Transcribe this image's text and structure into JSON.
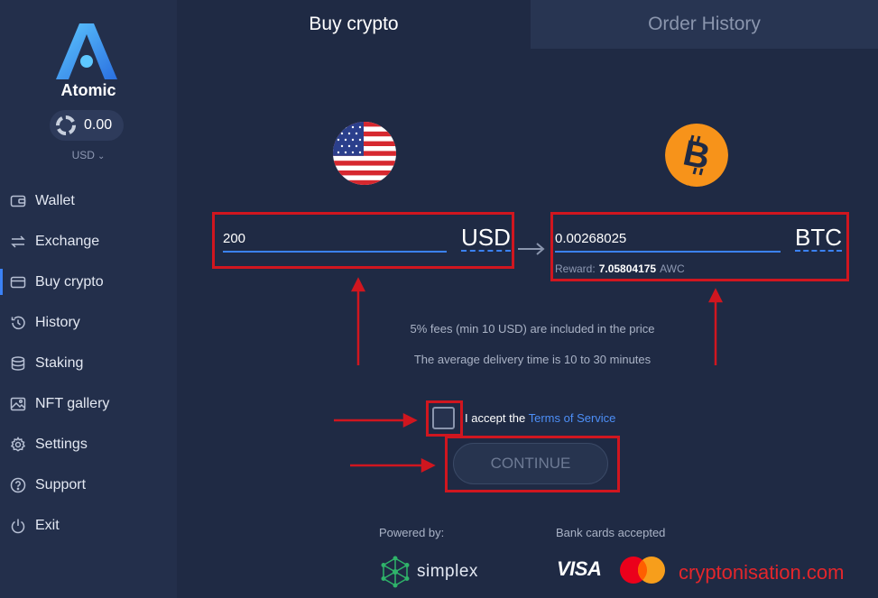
{
  "app": {
    "name": "Atomic"
  },
  "balance": {
    "value": "0.00",
    "currency": "USD"
  },
  "nav": [
    {
      "label": "Wallet",
      "icon": "wallet-icon"
    },
    {
      "label": "Exchange",
      "icon": "exchange-icon"
    },
    {
      "label": "Buy crypto",
      "icon": "card-icon",
      "active": true
    },
    {
      "label": "History",
      "icon": "history-icon"
    },
    {
      "label": "Staking",
      "icon": "staking-icon"
    },
    {
      "label": "NFT gallery",
      "icon": "image-icon"
    },
    {
      "label": "Settings",
      "icon": "gear-icon"
    },
    {
      "label": "Support",
      "icon": "help-icon"
    },
    {
      "label": "Exit",
      "icon": "power-icon"
    }
  ],
  "tabs": {
    "buy": "Buy crypto",
    "history": "Order History"
  },
  "buy": {
    "from_amount": "200",
    "from_unit": "USD",
    "to_amount": "0.00268025",
    "to_unit": "BTC",
    "reward_label": "Reward:",
    "reward_value": "7.05804175",
    "reward_unit": "AWC",
    "fees_text": "5% fees (min 10 USD) are included in the price",
    "delivery_text": "The average delivery time is 10 to 30 minutes",
    "terms_prefix": "I accept the",
    "terms_link": "Terms of Service",
    "continue_label": "CONTINUE"
  },
  "footer": {
    "powered_by": "Powered by:",
    "provider": "simplex",
    "cards_accepted": "Bank cards accepted",
    "visa": "VISA"
  },
  "watermark": "cryptonisation.com",
  "colors": {
    "background": "#1f2a44",
    "sidebar": "#232f4b",
    "accent": "#3b82f6",
    "annotation": "#d0161f",
    "bitcoin": "#f7931a"
  }
}
